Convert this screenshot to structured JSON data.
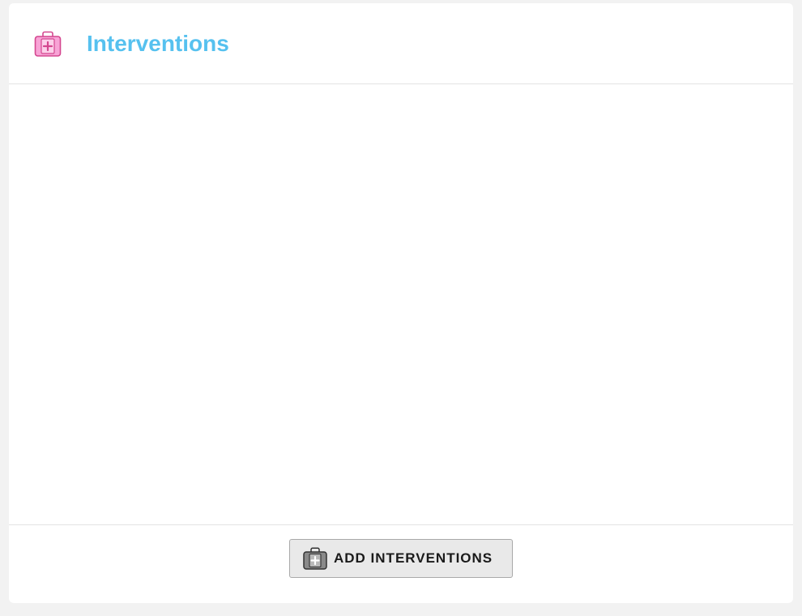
{
  "header": {
    "title": "Interventions",
    "icon": "first-aid-kit-icon",
    "title_color": "#56c1ef",
    "icon_color": "#f59ad4"
  },
  "footer": {
    "add_button_label": "ADD INTERVENTIONS",
    "add_button_icon": "first-aid-kit-icon"
  }
}
